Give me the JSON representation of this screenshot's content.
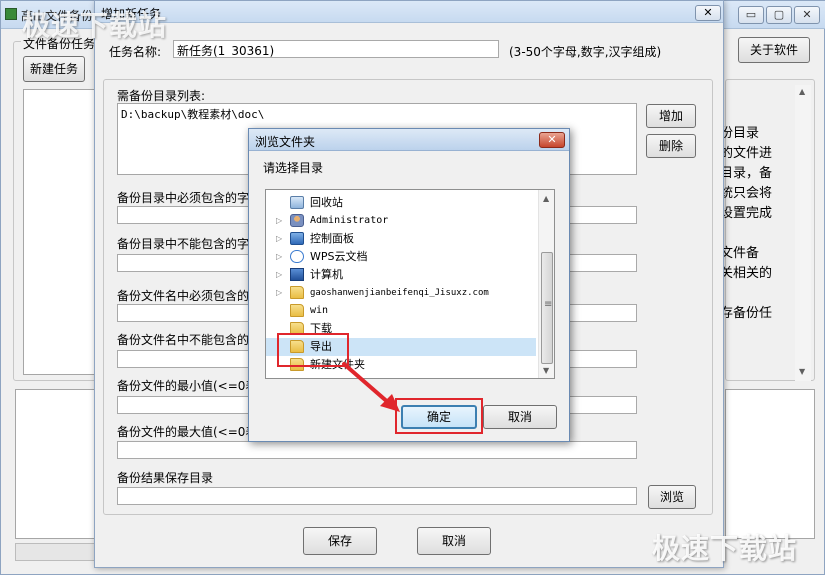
{
  "main_window": {
    "title": "高山文件备份",
    "window_buttons": {
      "minimize": "▭",
      "maximize": "▢",
      "close": "✕"
    },
    "task_group_label": "文件备份任务",
    "new_task_button": "新建任务",
    "about_button": "关于软件",
    "info_lines": [
      "份目录",
      "的文件进",
      "目录，备",
      "统只会将",
      "设置完成",
      "文件备",
      "关相关的",
      "存备份任"
    ]
  },
  "task_dialog": {
    "title": "增加新任务",
    "close_glyph": "✕",
    "task_name_label": "任务名称:",
    "task_name_value": "新任务(1_30361)",
    "task_name_hint": "(3-50个字母,数字,汉字组成)",
    "dir_list_label": "需备份目录列表:",
    "dir_list_entry": "D:\\backup\\教程素材\\doc\\",
    "add_button": "增加",
    "delete_button": "删除",
    "must_include_dir_label": "备份目录中必须包含的字",
    "exclude_dir_label": "备份目录中不能包含的字",
    "must_include_file_label": "备份文件名中必须包含的",
    "exclude_file_label": "备份文件名中不能包含的",
    "min_size_label": "备份文件的最小值(<=0表",
    "max_size_label": "备份文件的最大值(<=0表",
    "result_dir_label": "备份结果保存目录",
    "browse_button": "浏览",
    "save_button": "保存",
    "cancel_button": "取消"
  },
  "browse_dialog": {
    "title": "浏览文件夹",
    "close_glyph": "✕",
    "prompt": "请选择目录",
    "tree_items": [
      {
        "label": "回收站",
        "icon": "recycle-bin-icon",
        "expandable": false
      },
      {
        "label": "Administrator",
        "icon": "user-folder-icon",
        "expandable": true
      },
      {
        "label": "控制面板",
        "icon": "control-panel-icon",
        "expandable": true
      },
      {
        "label": "WPS云文档",
        "icon": "cloud-icon",
        "expandable": true
      },
      {
        "label": "计算机",
        "icon": "computer-icon",
        "expandable": true
      },
      {
        "label": "gaoshanwenjianbeifenqi_Jisuxz.com",
        "icon": "folder-icon",
        "expandable": true
      },
      {
        "label": "win",
        "icon": "folder-icon",
        "expandable": false
      },
      {
        "label": "下载",
        "icon": "folder-icon",
        "expandable": false
      },
      {
        "label": "导出",
        "icon": "folder-icon",
        "expandable": false,
        "selected": true
      },
      {
        "label": "新建文件夹",
        "icon": "folder-icon",
        "expandable": false
      }
    ],
    "expand_glyph": "▷",
    "scroll_up": "▲",
    "scroll_down": "▼",
    "scroll_grip": "≡",
    "ok_button": "确定",
    "cancel_button": "取消"
  },
  "watermark": {
    "text": "极速下载站"
  },
  "colors": {
    "annotation": "#e0262c",
    "titlebar": "#c7daf0",
    "selection": "#cce4f7"
  }
}
